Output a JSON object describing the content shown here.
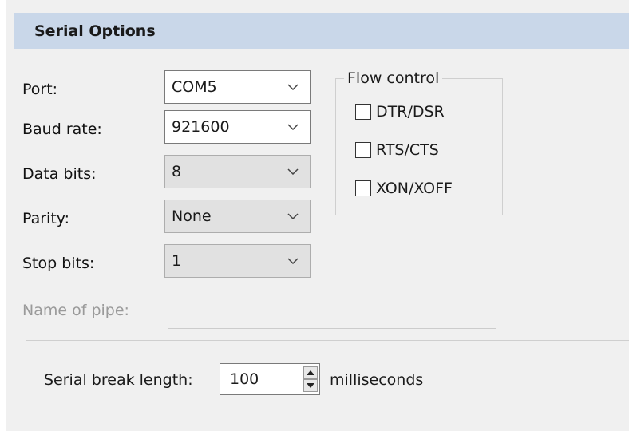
{
  "header": {
    "title": "Serial Options"
  },
  "fields": {
    "port": {
      "label": "Port:",
      "value": "COM5"
    },
    "baud": {
      "label": "Baud rate:",
      "value": "921600"
    },
    "data_bits": {
      "label": "Data bits:",
      "value": "8"
    },
    "parity": {
      "label": "Parity:",
      "value": "None"
    },
    "stop_bits": {
      "label": "Stop bits:",
      "value": "1"
    },
    "pipe": {
      "label": "Name of pipe:",
      "value": ""
    }
  },
  "flow_control": {
    "legend": "Flow control",
    "options": [
      {
        "label": "DTR/DSR",
        "checked": false
      },
      {
        "label": "RTS/CTS",
        "checked": false
      },
      {
        "label": "XON/XOFF",
        "checked": false
      }
    ]
  },
  "serial_break": {
    "label": "Serial break length:",
    "value": "100",
    "units": "milliseconds"
  },
  "icons": {
    "combo": "chevron-down-icon",
    "spin_up": "spin-up-icon",
    "spin_down": "spin-down-icon"
  }
}
